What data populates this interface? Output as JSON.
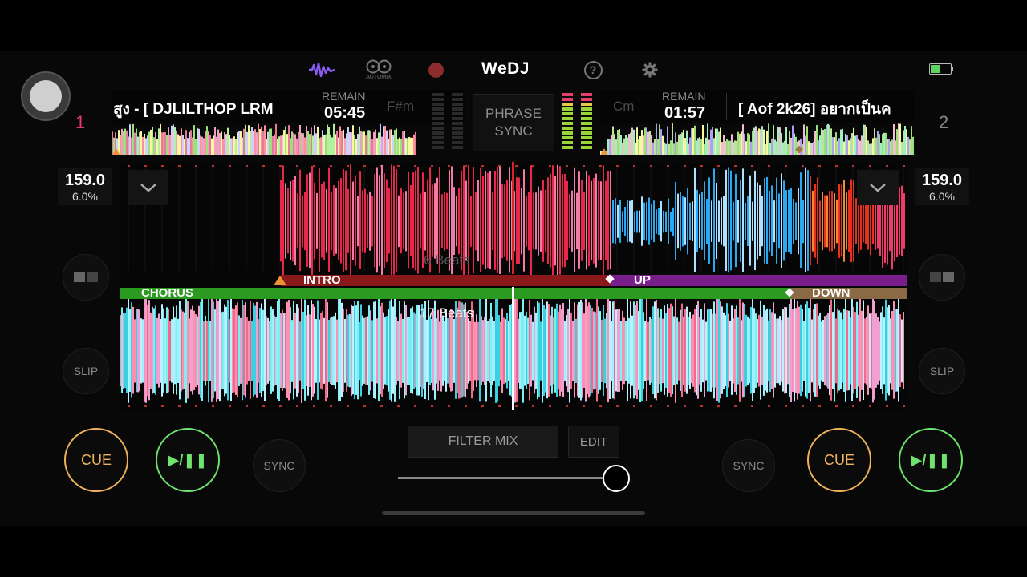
{
  "app": {
    "name": "WeDJ",
    "automix_label": "AUTOMIX"
  },
  "colors": {
    "cue": "#f0b35c",
    "play": "#6ee36e",
    "deck1_num": "#e8327a",
    "accent_wave": "#8a5cf6",
    "record": "#8b2d2d"
  },
  "icons": [
    "waveform-icon",
    "automix-icon",
    "record-icon",
    "help-icon",
    "gear-icon",
    "battery-icon",
    "home-button-icon",
    "chevron-down-icon",
    "play-pause-icon"
  ],
  "deck1": {
    "number": "1",
    "title": "สูง  - [ DJLILTHOP LRM",
    "remain_label": "REMAIN",
    "remain": "05:45",
    "key": "F#m",
    "bpm": "159.0",
    "pitch": "6.0%",
    "slip": "SLIP",
    "sync": "SYNC",
    "cue": "CUE",
    "play": "▶/❚❚",
    "beats": "17 Beats",
    "phrases": [
      "CHORUS",
      "DOWN"
    ]
  },
  "deck2": {
    "number": "2",
    "title": "[ Aof 2k26] อยากเป็นค",
    "remain_label": "REMAIN",
    "remain": "01:57",
    "key": "Cm",
    "bpm": "159.0",
    "pitch": "6.0%",
    "slip": "SLIP",
    "sync": "SYNC",
    "cue": "CUE",
    "play": "▶/❚❚",
    "beats": "6 Beats",
    "phrases": [
      "INTRO",
      "UP"
    ]
  },
  "center": {
    "phrase_sync_line1": "PHRASE",
    "phrase_sync_line2": "SYNC",
    "filter_mix": "FILTER MIX",
    "edit": "EDIT",
    "crossfader_position": 0.95
  }
}
